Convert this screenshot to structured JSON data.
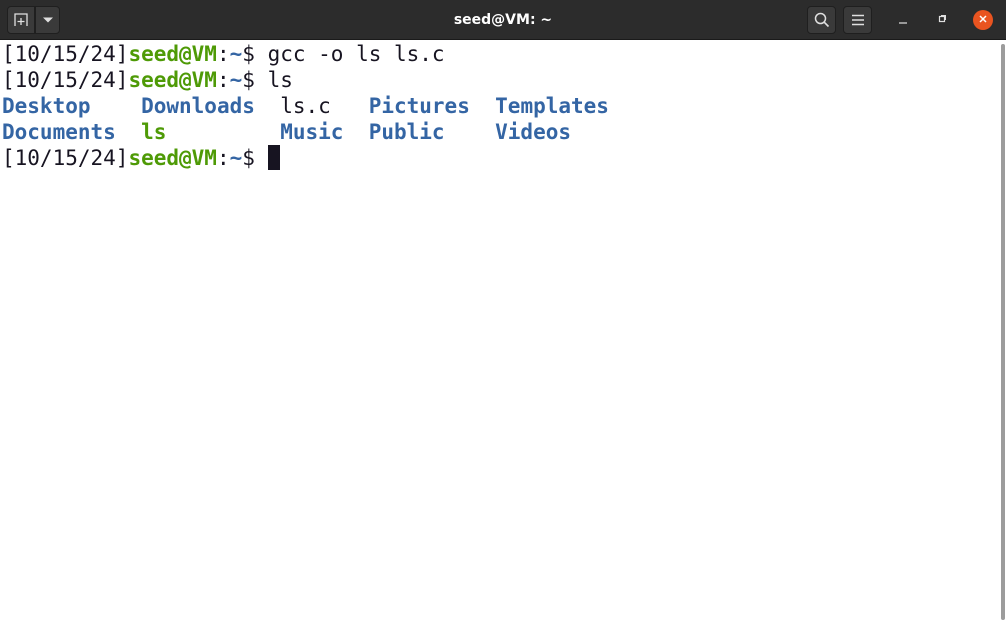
{
  "window": {
    "title": "seed@VM: ~"
  },
  "headerbar": {
    "new_tab_icon": "new-tab-icon",
    "dropdown_icon": "chevron-down-icon",
    "search_icon": "search-icon",
    "menu_icon": "hamburger-menu-icon",
    "minimize_icon": "minimize-icon",
    "maximize_icon": "maximize-icon",
    "close_icon": "close-icon"
  },
  "colors": {
    "headerbar_bg": "#2c2c2c",
    "close_button": "#e95420",
    "prompt_user": "#4e9a06",
    "prompt_path": "#3465a4",
    "directory": "#3465a4",
    "executable": "#4e9a06",
    "text": "#171421"
  },
  "terminal": {
    "prompt": {
      "date": "[10/15/24]",
      "user_host": "seed@VM",
      "colon": ":",
      "path": "~",
      "symbol": "$"
    },
    "lines": [
      {
        "command": " gcc -o ls ls.c"
      },
      {
        "command": " ls"
      },
      {
        "command": " "
      }
    ],
    "ls_output": {
      "row1": [
        {
          "name": "Desktop",
          "pad": "    ",
          "type": "dir"
        },
        {
          "name": "Downloads",
          "pad": "  ",
          "type": "dir"
        },
        {
          "name": "ls.c",
          "pad": "   ",
          "type": "file"
        },
        {
          "name": "Pictures",
          "pad": "  ",
          "type": "dir"
        },
        {
          "name": "Templates",
          "pad": "",
          "type": "dir"
        }
      ],
      "row2": [
        {
          "name": "Documents",
          "pad": "  ",
          "type": "dir"
        },
        {
          "name": "ls",
          "pad": "         ",
          "type": "exe"
        },
        {
          "name": "Music",
          "pad": "  ",
          "type": "dir"
        },
        {
          "name": "Public",
          "pad": "    ",
          "type": "dir"
        },
        {
          "name": "Videos",
          "pad": "",
          "type": "dir"
        }
      ]
    }
  }
}
